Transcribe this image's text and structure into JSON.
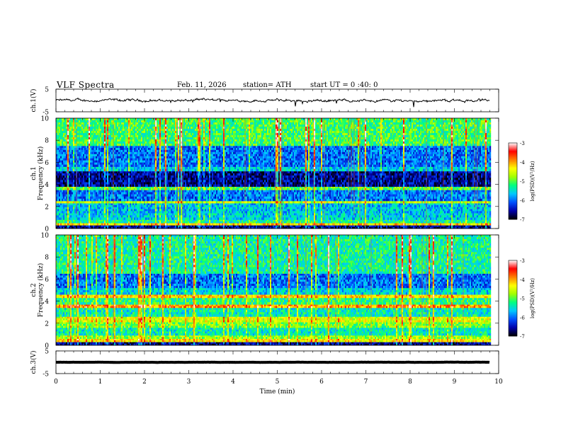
{
  "header": {
    "title": "VLF Spectra",
    "date": "Feb. 11, 2026",
    "station": "station= ATH",
    "start_ut": "start UT = 0 :40: 0"
  },
  "chart_data": [
    {
      "type": "line",
      "panel": "ch1-waveform",
      "ylabel": "ch.1(V)",
      "ylim": [
        -5,
        5
      ],
      "yticks": [
        "5",
        "-5"
      ],
      "xlim": [
        0,
        10
      ],
      "series": [
        {
          "values_description_none": "",
          "baseline": 0.0,
          "noise_amplitude": 0.6,
          "x_end": 9.8
        }
      ]
    },
    {
      "type": "heatmap",
      "panel": "ch1-spectrogram",
      "ylabel_line1": "ch.1",
      "ylabel_line2": "Frequency (kHz)",
      "ylim": [
        0,
        10
      ],
      "yticks": [
        "0",
        "2",
        "4",
        "6",
        "8",
        "10"
      ],
      "xlim": [
        0,
        10
      ],
      "x_end": 9.8,
      "colorbar": {
        "label": "log(PSD)(V²/Hz)",
        "range": [
          -7,
          -3
        ],
        "ticks": [
          "-3",
          "-4",
          "-5",
          "-6",
          "-7"
        ]
      },
      "bands_log_psd": [
        {
          "f0": 0.0,
          "f1": 0.3,
          "v": -6.6
        },
        {
          "f0": 0.3,
          "f1": 0.5,
          "v": -4.2
        },
        {
          "f0": 0.5,
          "f1": 0.8,
          "v": -5.3
        },
        {
          "f0": 0.8,
          "f1": 1.4,
          "v": -5.6
        },
        {
          "f0": 1.4,
          "f1": 2.3,
          "v": -5.7
        },
        {
          "f0": 2.3,
          "f1": 2.5,
          "v": -4.6
        },
        {
          "f0": 2.5,
          "f1": 3.5,
          "v": -6.0
        },
        {
          "f0": 3.5,
          "f1": 3.8,
          "v": -5.0
        },
        {
          "f0": 3.8,
          "f1": 5.2,
          "v": -6.6
        },
        {
          "f0": 5.2,
          "f1": 5.6,
          "v": -5.6
        },
        {
          "f0": 5.6,
          "f1": 7.5,
          "v": -6.0
        },
        {
          "f0": 7.5,
          "f1": 10.0,
          "v": -5.1
        }
      ]
    },
    {
      "type": "heatmap",
      "panel": "ch2-spectrogram",
      "ylabel_line1": "ch.2",
      "ylabel_line2": "Frequency (kHz)",
      "ylim": [
        0,
        10
      ],
      "yticks": [
        "0",
        "2",
        "4",
        "6",
        "8",
        "10"
      ],
      "xlim": [
        0,
        10
      ],
      "x_end": 9.8,
      "colorbar": {
        "label": "log(PSD)(V²/Hz)",
        "range": [
          -7,
          -3
        ],
        "ticks": [
          "-3",
          "-4",
          "-5",
          "-6",
          "-7"
        ]
      },
      "bands_log_psd": [
        {
          "f0": 0.0,
          "f1": 0.3,
          "v": -6.6
        },
        {
          "f0": 0.3,
          "f1": 0.6,
          "v": -4.3
        },
        {
          "f0": 0.6,
          "f1": 0.9,
          "v": -4.8
        },
        {
          "f0": 0.9,
          "f1": 1.6,
          "v": -5.4
        },
        {
          "f0": 1.6,
          "f1": 2.1,
          "v": -4.9
        },
        {
          "f0": 2.1,
          "f1": 2.6,
          "v": -4.5
        },
        {
          "f0": 2.6,
          "f1": 3.4,
          "v": -5.4
        },
        {
          "f0": 3.4,
          "f1": 3.7,
          "v": -4.0
        },
        {
          "f0": 3.7,
          "f1": 4.3,
          "v": -5.2
        },
        {
          "f0": 4.3,
          "f1": 4.6,
          "v": -4.2
        },
        {
          "f0": 4.6,
          "f1": 5.2,
          "v": -5.6
        },
        {
          "f0": 5.2,
          "f1": 6.5,
          "v": -6.0
        },
        {
          "f0": 6.5,
          "f1": 10.0,
          "v": -5.3
        }
      ]
    },
    {
      "type": "line",
      "panel": "ch3-waveform",
      "ylabel": "ch.3(V)",
      "ylim": [
        -5,
        5
      ],
      "yticks": [
        "5",
        "-5"
      ],
      "xlim": [
        0,
        10
      ],
      "xlabel": "Time (min)",
      "xticks": [
        "0",
        "1",
        "2",
        "3",
        "4",
        "5",
        "6",
        "7",
        "8",
        "9",
        "10"
      ],
      "series": [
        {
          "baseline": 0.0,
          "noise_amplitude": 0.05,
          "x_end": 9.8
        }
      ]
    }
  ],
  "colors": {
    "axis": "#000000",
    "trace": "#000000",
    "colormap": [
      "#000000",
      "#0000aa",
      "#0050ff",
      "#00c8ff",
      "#00ff80",
      "#a0ff00",
      "#ffff00",
      "#ff8000",
      "#ff0000",
      "#ffffff"
    ]
  }
}
